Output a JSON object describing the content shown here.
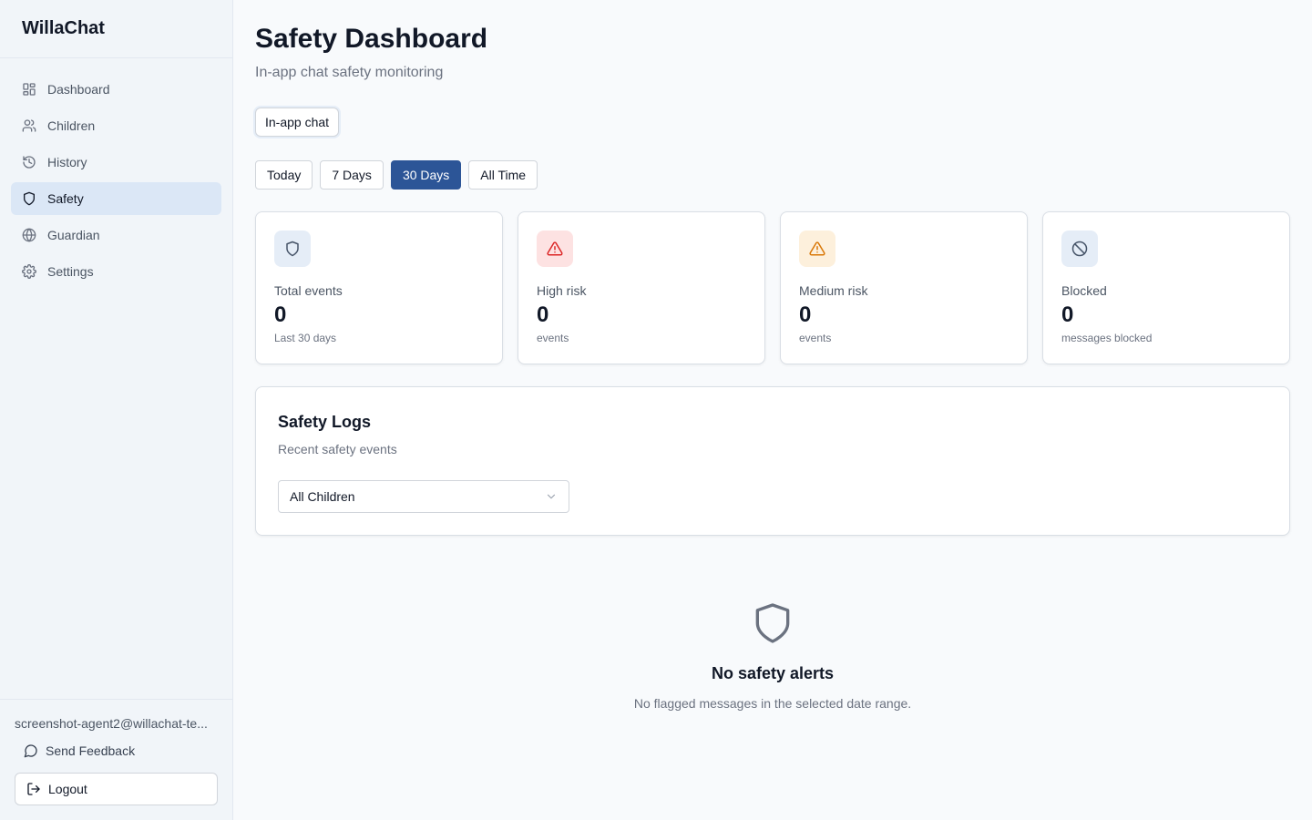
{
  "app": {
    "name": "WillaChat"
  },
  "sidebar": {
    "items": [
      {
        "label": "Dashboard",
        "icon": "dashboard-icon",
        "active": false
      },
      {
        "label": "Children",
        "icon": "users-icon",
        "active": false
      },
      {
        "label": "History",
        "icon": "history-icon",
        "active": false
      },
      {
        "label": "Safety",
        "icon": "shield-icon",
        "active": true
      },
      {
        "label": "Guardian",
        "icon": "globe-icon",
        "active": false
      },
      {
        "label": "Settings",
        "icon": "gear-icon",
        "active": false
      }
    ],
    "user_email": "screenshot-agent2@willachat-te...",
    "feedback_label": "Send Feedback",
    "logout_label": "Logout"
  },
  "header": {
    "title": "Safety Dashboard",
    "subtitle": "In-app chat safety monitoring",
    "channel": "In-app chat"
  },
  "ranges": {
    "options": [
      "Today",
      "7 Days",
      "30 Days",
      "All Time"
    ],
    "selected": "30 Days"
  },
  "stats": [
    {
      "label": "Total events",
      "value": "0",
      "note": "Last 30 days",
      "icon": "shield-icon",
      "icon_bg": "#e5edf7",
      "icon_color": "#475569"
    },
    {
      "label": "High risk",
      "value": "0",
      "note": "events",
      "icon": "alert-triangle-icon",
      "icon_bg": "#fde2e2",
      "icon_color": "#dc2626"
    },
    {
      "label": "Medium risk",
      "value": "0",
      "note": "events",
      "icon": "alert-triangle-icon",
      "icon_bg": "#fdf0dc",
      "icon_color": "#d97706"
    },
    {
      "label": "Blocked",
      "value": "0",
      "note": "messages blocked",
      "icon": "ban-icon",
      "icon_bg": "#e5edf7",
      "icon_color": "#475569"
    }
  ],
  "logs": {
    "title": "Safety Logs",
    "subtitle": "Recent safety events",
    "filter_value": "All Children"
  },
  "empty_state": {
    "icon": "shield-icon",
    "title": "No safety alerts",
    "message": "No flagged messages in the selected date range."
  },
  "colors": {
    "accent": "#2c5597",
    "active_nav_bg": "#dbe7f6"
  }
}
